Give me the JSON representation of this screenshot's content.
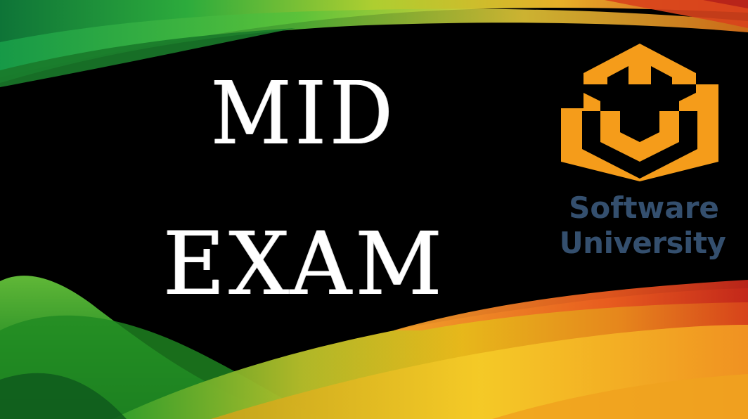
{
  "slide": {
    "title_line_1": "MID",
    "title_line_2": "EXAM",
    "background_color": "#000000",
    "title_color": "#ffffff"
  },
  "logo": {
    "icon": "software-university-box-icon",
    "text_line_1": "Software",
    "text_line_2": "University",
    "icon_color": "#f59c1a",
    "text_color": "#344f6e"
  },
  "decoration": {
    "colors": [
      "#1f8a2e",
      "#3fbf3a",
      "#9ad43a",
      "#f2c21a",
      "#f08a1c",
      "#e4461e",
      "#c2261a"
    ]
  }
}
